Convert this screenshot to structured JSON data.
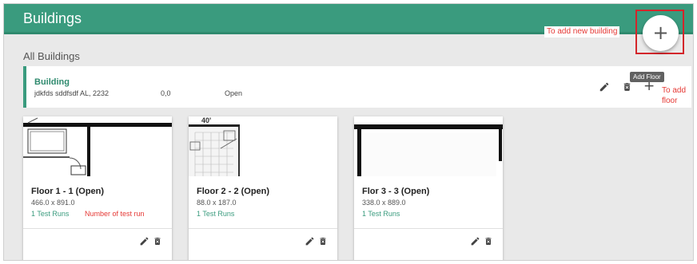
{
  "header": {
    "title": "Buildings"
  },
  "callouts": {
    "add_building": "To add new building",
    "add_floor": "To add floor",
    "test_runs": "Number of test run"
  },
  "fab": {
    "label": "+"
  },
  "section": {
    "title": "All Buildings"
  },
  "building": {
    "name": "Building",
    "address": "jdkfds sddfsdf AL, 2232",
    "coords": "0,0",
    "status": "Open",
    "tooltip": "Add Floor",
    "add_label": "+"
  },
  "floors": [
    {
      "name": "Floor 1 - 1 (Open)",
      "dims": "466.0 x 891.0",
      "runs": "1 Test Runs"
    },
    {
      "name": "Floor 2 - 2 (Open)",
      "dims": "88.0 x 187.0",
      "runs": "1 Test Runs",
      "plan_label": "40'"
    },
    {
      "name": "Flor 3 - 3 (Open)",
      "dims": "338.0 x 889.0",
      "runs": "1 Test Runs"
    }
  ],
  "icons": {
    "edit": "pencil-icon",
    "delete": "trash-icon"
  },
  "colors": {
    "primary": "#3a9b7e",
    "callout": "#e53935",
    "highlight_box": "#d3262b"
  }
}
